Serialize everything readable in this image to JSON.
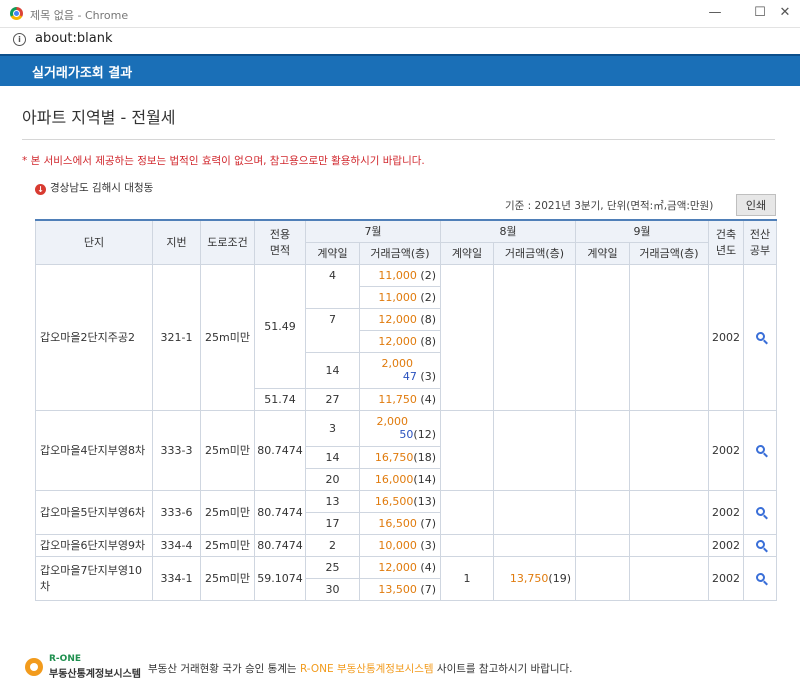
{
  "window": {
    "title": "제목 없음 - Chrome",
    "minimize": "—",
    "maximize": "☐",
    "close": "✕"
  },
  "address": {
    "url": "about:blank"
  },
  "header": {
    "title": "실거래가조회 결과"
  },
  "page": {
    "title": "아파트 지역별 - 전월세",
    "notice": "* 본 서비스에서 제공하는 정보는 법적인 효력이 없으며, 참고용으로만 활용하시기 바랍니다.",
    "region": "경상남도 김해시 대청동",
    "basis": "기준 : 2021년 3분기, 단위(면적:㎡,금액:만원)",
    "print": "인쇄"
  },
  "table": {
    "headers": {
      "complex": "단지",
      "lot": "지번",
      "road": "도로조건",
      "area": "전용\n면적",
      "jul": "7월",
      "aug": "8월",
      "sep": "9월",
      "contract_day": "계약일",
      "amount": "거래금액(층)",
      "built": "건축\n년도",
      "registry": "전산\n공부"
    },
    "rows": [
      {
        "name": "갑오마을2단지주공2",
        "lot": "321-1",
        "road": "25m미만",
        "built": "2002"
      },
      {
        "name": "갑오마을4단지부영8차",
        "lot": "333-3",
        "road": "25m미만",
        "built": "2002"
      },
      {
        "name": "갑오마을5단지부영6차",
        "lot": "333-6",
        "road": "25m미만",
        "built": "2002"
      },
      {
        "name": "갑오마을6단지부영9차",
        "lot": "334-4",
        "road": "25m미만",
        "built": "2002"
      },
      {
        "name": "갑오마을7단지부영10차",
        "lot": "334-1",
        "road": "25m미만",
        "built": "2002"
      }
    ],
    "areas": [
      "51.49",
      "51.74",
      "80.7474",
      "80.7474",
      "80.7474",
      "59.1074"
    ],
    "deals": {
      "r1": {
        "d1": "4",
        "a1": "11,000",
        "f1": "(2)",
        "a2": "11,000",
        "f2": "(2)",
        "d2": "7",
        "a3": "12,000",
        "f3": "(8)",
        "a4": "12,000",
        "f4": "(8)",
        "d3": "14",
        "a5": "2,000",
        "a5b": "47",
        "f5": "(3)",
        "d4": "27",
        "a6": "11,750",
        "f6": "(4)"
      },
      "r2": {
        "d1": "3",
        "a1": "2,000",
        "a1b": "50",
        "f1": "(12)",
        "d2": "14",
        "a2": "16,750",
        "f2": "(18)",
        "d3": "20",
        "a3": "16,000",
        "f3": "(14)"
      },
      "r3": {
        "d1": "13",
        "a1": "16,500",
        "f1": "(13)",
        "d2": "17",
        "a2": "16,500",
        "f2": "(7)"
      },
      "r4": {
        "d1": "2",
        "a1": "10,000",
        "f1": "(3)"
      },
      "r5": {
        "d1": "25",
        "a1": "12,000",
        "f1": "(4)",
        "d2": "30",
        "a2": "13,500",
        "f2": "(7)",
        "aug_day": "1",
        "aug_amt": "13,750",
        "aug_floor": "(19)"
      }
    }
  },
  "footer": {
    "logo_top": "R-ONE",
    "logo_bottom": "부동산통계정보시스템",
    "text_pre": "부동산 거래현황 국가 승인 통계는 ",
    "brand": "R-ONE 부동산통계정보시스템",
    "text_post": " 사이트를 참고하시기 바랍니다."
  }
}
